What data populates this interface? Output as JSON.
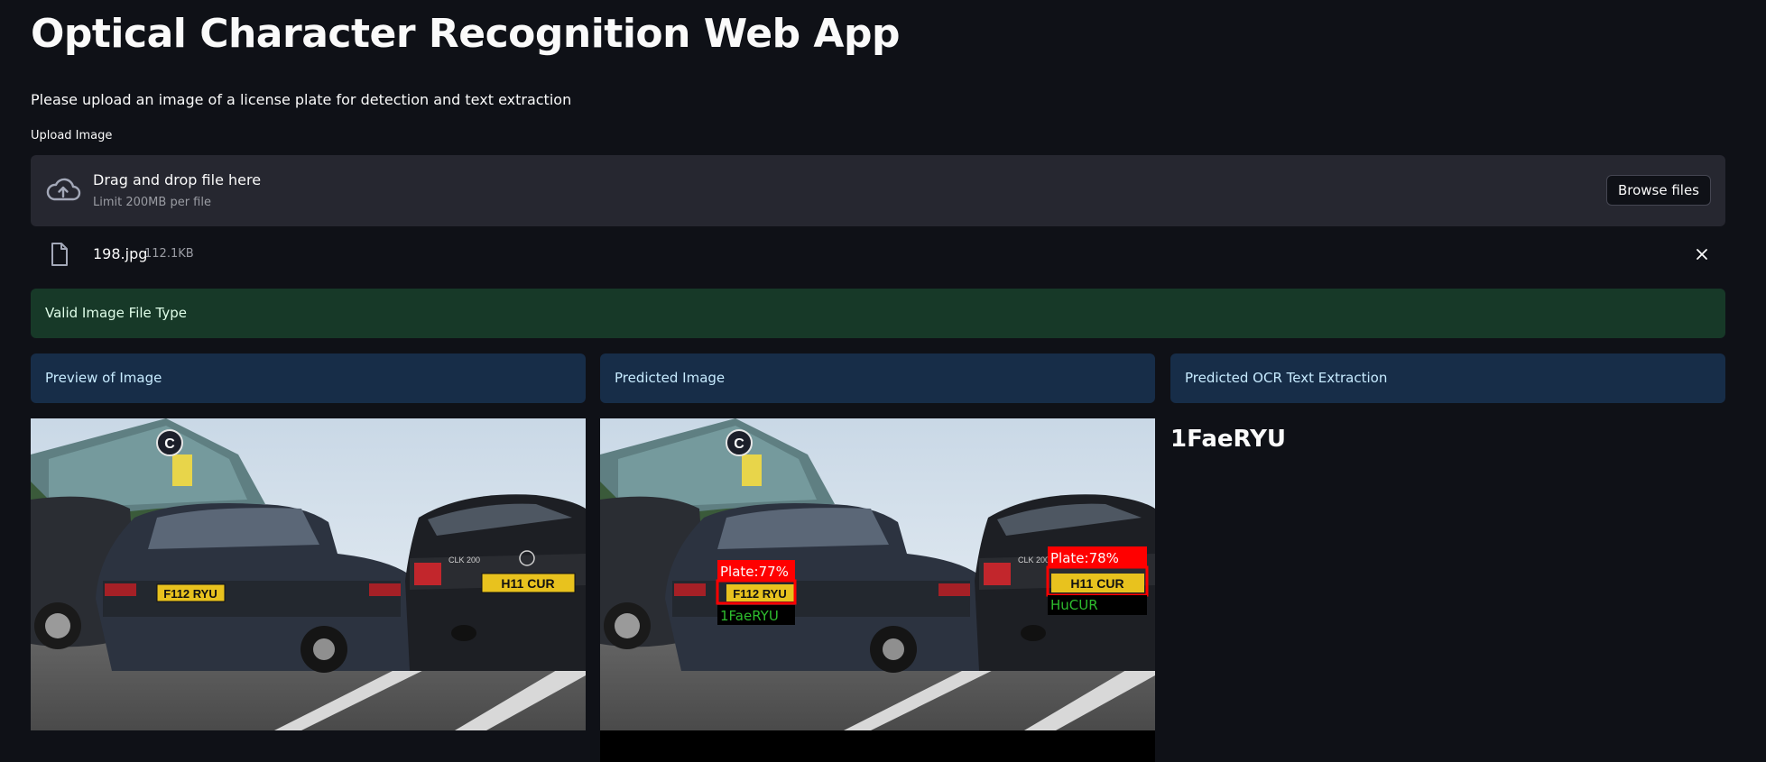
{
  "app": {
    "title": "Optical Character Recognition Web App",
    "subtitle": "Please upload an image of a license plate for detection and text extraction"
  },
  "uploader": {
    "label": "Upload Image",
    "drop_text": "Drag and drop file here",
    "limit_text": "Limit 200MB per file",
    "browse_label": "Browse files",
    "icon": "cloud-upload-icon"
  },
  "file": {
    "name": "198.jpg",
    "size": "112.1KB",
    "icon": "file-icon"
  },
  "status": {
    "success": "Valid Image File Type"
  },
  "columns": {
    "preview_header": "Preview of Image",
    "predicted_header": "Predicted Image",
    "ocr_header": "Predicted OCR Text Extraction"
  },
  "scene": {
    "plate_left": "F112 RYU",
    "plate_right": "H11 CUR",
    "badge_letter": "C",
    "car_badge": "CLK 200"
  },
  "predictions": [
    {
      "label": "Plate:77%",
      "ocr": "1FaeRYU"
    },
    {
      "label": "Plate:78%",
      "ocr": "HuCUR"
    }
  ],
  "ocr_result": "1FaeRYU",
  "colors": {
    "background": "#0f1117",
    "success_bg": "#173928",
    "info_bg": "#172d48",
    "box_red": "#ff0000",
    "ocr_green": "#2ebd2e"
  }
}
